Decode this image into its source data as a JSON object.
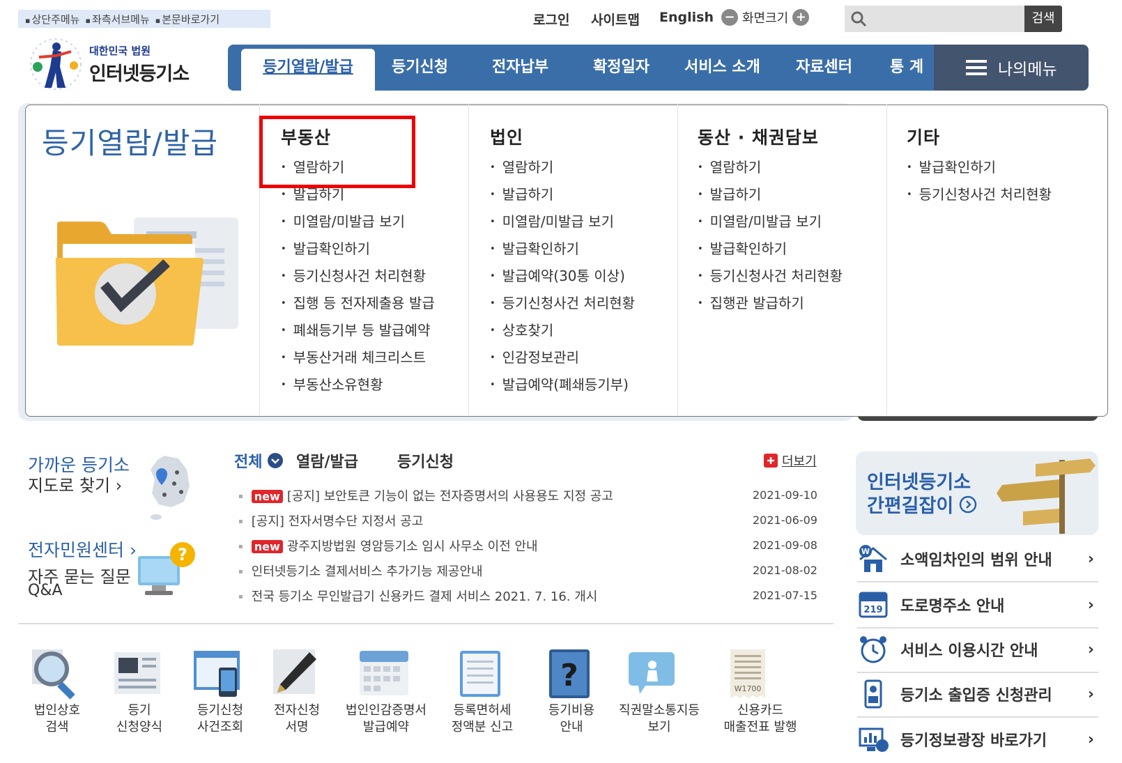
{
  "skip_links": [
    "상단주메뉴",
    "좌측서브메뉴",
    "본문바로가기"
  ],
  "util": {
    "login": "로그인",
    "sitemap": "사이트맵",
    "english": "English",
    "zoom_label": "화면크기",
    "zoom_minus": "−",
    "zoom_plus": "+"
  },
  "search": {
    "button": "검색",
    "placeholder": ""
  },
  "logo": {
    "line1": "대한민국 법원",
    "line2": "인터넷등기소"
  },
  "nav": {
    "items": [
      "등기열람/발급",
      "등기신청",
      "전자납부",
      "확정일자",
      "서비스 소개",
      "자료센터",
      "통 계"
    ],
    "mymenu": "나의메뉴"
  },
  "dropdown": {
    "title": "등기열람/발급",
    "columns": [
      {
        "heading": "부동산",
        "items": [
          "열람하기",
          "발급하기",
          "미열람/미발급 보기",
          "발급확인하기",
          "등기신청사건 처리현황",
          "집행 등 전자제출용 발급",
          "폐쇄등기부 등 발급예약",
          "부동산거래 체크리스트",
          "부동산소유현황"
        ]
      },
      {
        "heading": "법인",
        "items": [
          "열람하기",
          "발급하기",
          "미열람/미발급 보기",
          "발급확인하기",
          "발급예약(30통 이상)",
          "등기신청사건 처리현황",
          "상호찾기",
          "인감정보관리",
          "발급예약(폐쇄등기부)"
        ]
      },
      {
        "heading": "동산 · 채권담보",
        "items": [
          "열람하기",
          "발급하기",
          "미열람/미발급 보기",
          "발급확인하기",
          "등기신청사건 처리현황",
          "집행관 발급하기"
        ]
      },
      {
        "heading": "기타",
        "items": [
          "발급확인하기",
          "등기신청사건 처리현황"
        ]
      }
    ]
  },
  "left_links": {
    "nearby1": "가까운 등기소",
    "nearby2": "지도로 찾기 ›",
    "ecenter": "전자민원센터 ›",
    "faq1": "자주 묻는 질문",
    "faq2": "Q&A"
  },
  "news": {
    "tabs": [
      "전체",
      "열람/발급",
      "등기신청"
    ],
    "more": "더보기",
    "new_tag": "new",
    "items": [
      {
        "new": true,
        "title": "[공지] 보안토큰 기능이 없는 전자증명서의 사용용도 지정 공고",
        "date": "2021-09-10"
      },
      {
        "new": false,
        "title": "[공지] 전자서명수단 지정서 공고",
        "date": "2021-06-09"
      },
      {
        "new": true,
        "title": "광주지방법원 영암등기소 임시 사무소 이전 안내",
        "date": "2021-09-08"
      },
      {
        "new": false,
        "title": "인터넷등기소 결제서비스 추가기능 제공안내",
        "date": "2021-08-02"
      },
      {
        "new": false,
        "title": "전국 등기소 무인발급기 신용카드 결제 서비스 2021. 7. 16. 개시",
        "date": "2021-07-15"
      }
    ]
  },
  "guide": {
    "line1": "인터넷등기소",
    "line2": "간편길잡이"
  },
  "right_links": [
    "소액임차인의 범위 안내",
    "도로명주소 안내",
    "서비스 이용시간 안내",
    "등기소 출입증 신청관리",
    "등기정보광장 바로가기"
  ],
  "quick": [
    {
      "l1": "법인상호",
      "l2": "검색"
    },
    {
      "l1": "등기",
      "l2": "신청양식"
    },
    {
      "l1": "등기신청",
      "l2": "사건조회"
    },
    {
      "l1": "전자신청",
      "l2": "서명"
    },
    {
      "l1": "법인인감증명서",
      "l2": "발급예약"
    },
    {
      "l1": "등록면허세",
      "l2": "정액분 신고"
    },
    {
      "l1": "등기비용",
      "l2": "안내"
    },
    {
      "l1": "직권말소통지등",
      "l2": "보기"
    },
    {
      "l1": "신용카드",
      "l2": "매출전표 발행"
    }
  ],
  "colors": {
    "nav": "#3a6ea9",
    "mymenu": "#43546f",
    "title_blue": "#2f63a6",
    "highlight": "#ee0000",
    "new": "#e0262b"
  }
}
